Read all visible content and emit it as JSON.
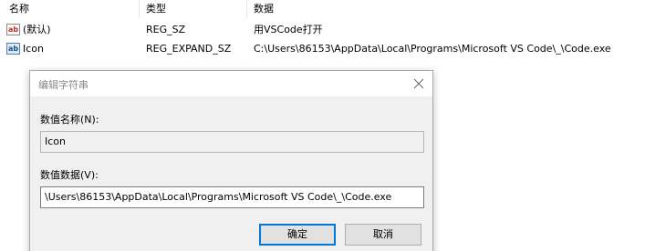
{
  "list": {
    "columns": [
      "名称",
      "类型",
      "数据"
    ],
    "rows": [
      {
        "icon": "string-value-icon",
        "name": "(默认)",
        "type": "REG_SZ",
        "data": "用VSCode打开"
      },
      {
        "icon": "string-value-icon",
        "name": "Icon",
        "type": "REG_EXPAND_SZ",
        "data": "C:\\Users\\86153\\AppData\\Local\\Programs\\Microsoft VS Code\\_\\Code.exe"
      }
    ]
  },
  "dialog": {
    "title": "编辑字符串",
    "name_label": "数值名称(N):",
    "name_value": "Icon",
    "data_label": "数值数据(V):",
    "data_value": "\\Users\\86153\\AppData\\Local\\Programs\\Microsoft VS Code\\_\\Code.exe",
    "ok_label": "确定",
    "cancel_label": "取消"
  },
  "colors": {
    "accent": "#0078d7",
    "dialog_bg": "#f0f0f0"
  }
}
